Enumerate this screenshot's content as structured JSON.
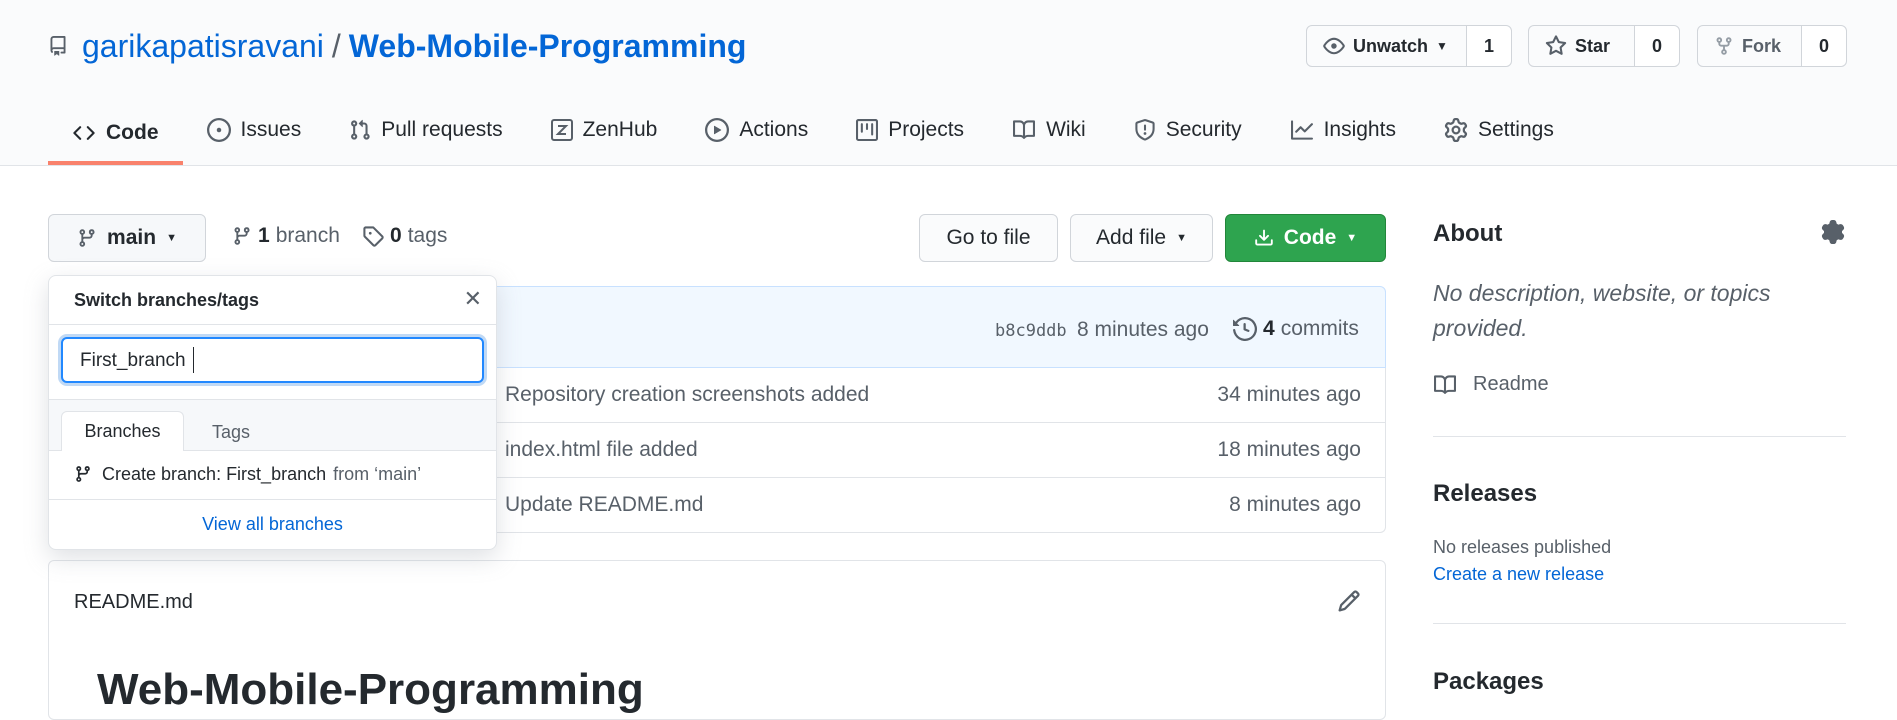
{
  "repo": {
    "owner": "garikapatisravani",
    "separator": "/",
    "name": "Web-Mobile-Programming"
  },
  "header_actions": {
    "watch": {
      "label": "Unwatch",
      "count": "1"
    },
    "star": {
      "label": "Star",
      "count": "0"
    },
    "fork": {
      "label": "Fork",
      "count": "0"
    }
  },
  "nav": {
    "code": "Code",
    "issues": "Issues",
    "pulls": "Pull requests",
    "zenhub": "ZenHub",
    "actions": "Actions",
    "projects": "Projects",
    "wiki": "Wiki",
    "security": "Security",
    "insights": "Insights",
    "settings": "Settings"
  },
  "toolbar": {
    "branch": "main",
    "branch_count": "1",
    "branch_word": "branch",
    "tag_count": "0",
    "tag_word": "tags",
    "go_to_file": "Go to file",
    "add_file": "Add file",
    "code": "Code"
  },
  "commit_bar": {
    "sha": "b8c9ddb",
    "age": "8 minutes ago",
    "commit_count": "4",
    "commit_word": "commits"
  },
  "files": [
    {
      "message": "Repository creation screenshots added",
      "age": "34 minutes ago"
    },
    {
      "message": "index.html file added",
      "age": "18 minutes ago"
    },
    {
      "message": "Update README.md",
      "age": "8 minutes ago"
    }
  ],
  "branch_dropdown": {
    "title": "Switch branches/tags",
    "filter_value": "First_branch",
    "tab_branches": "Branches",
    "tab_tags": "Tags",
    "create_prefix": "Create branch: First_branch",
    "create_suffix": "from ‘main’",
    "view_all": "View all branches"
  },
  "readme": {
    "filename": "README.md",
    "heading": "Web-Mobile-Programming"
  },
  "sidebar": {
    "about_title": "About",
    "about_text": "No description, website, or topics provided.",
    "readme_link": "Readme",
    "releases_title": "Releases",
    "releases_text": "No releases published",
    "releases_link": "Create a new release",
    "packages_title": "Packages"
  },
  "colors": {
    "accent": "#0366d6",
    "green": "#2ea44f",
    "tab_underline": "#f9826c"
  }
}
